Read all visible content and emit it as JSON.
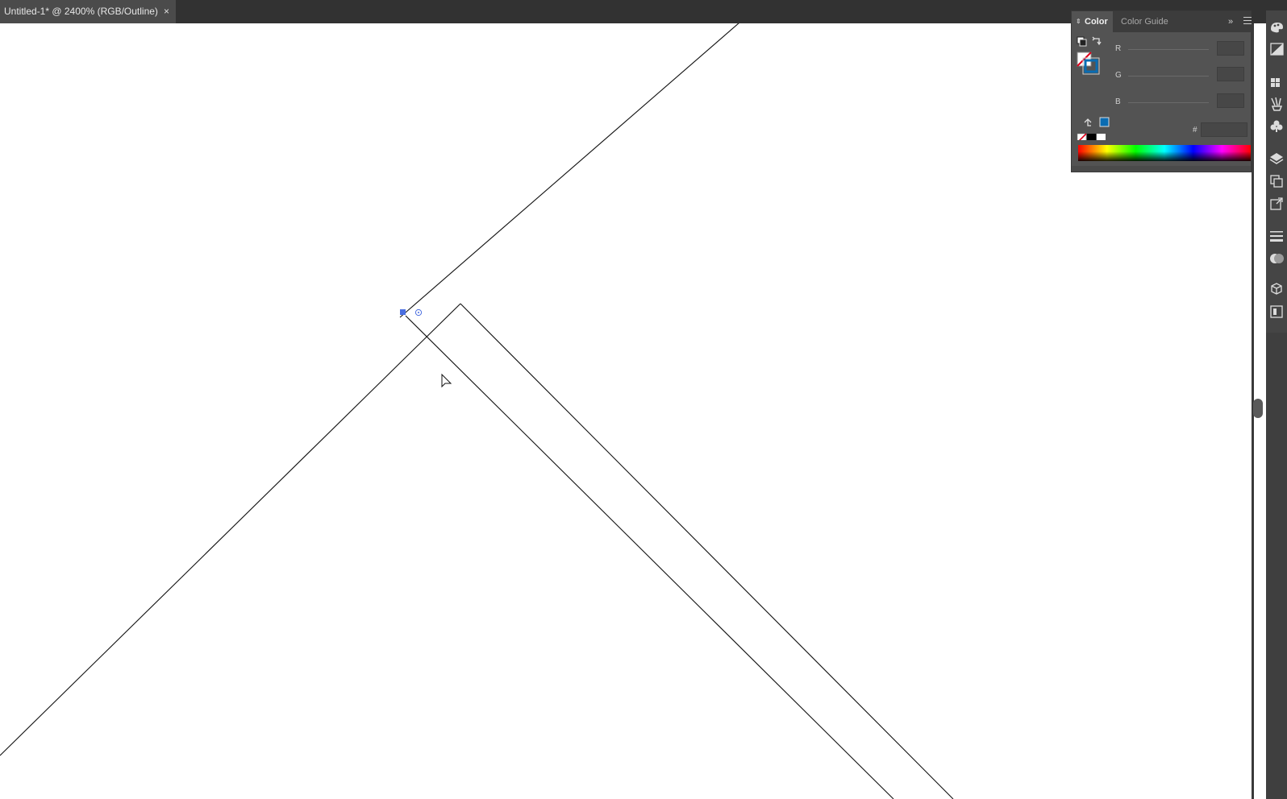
{
  "document_tab": {
    "title": "Untitled-1* @ 2400% (RGB/Outline)",
    "close_glyph": "×"
  },
  "color_panel": {
    "tabs": [
      {
        "label": "Color",
        "active": true
      },
      {
        "label": "Color Guide",
        "active": false
      }
    ],
    "tab_arrows_glyph": "⇕",
    "collapse_glyph": "»",
    "sliders": [
      {
        "label": "R",
        "value": ""
      },
      {
        "label": "G",
        "value": ""
      },
      {
        "label": "B",
        "value": ""
      }
    ],
    "hex_label": "#",
    "hex_value": "",
    "fill": "none",
    "stroke_color": "#0a6cb2"
  },
  "right_dock": {
    "icons": [
      "color-icon",
      "gradient-icon",
      "swatches-icon",
      "brushes-icon",
      "symbols-icon",
      "layers-icon",
      "artboards-icon",
      "links-icon",
      "stroke-icon",
      "transparency-icon",
      "3d-icon",
      "libraries-icon"
    ]
  },
  "colors": {
    "ui_dark": "#323232",
    "panel_bg": "#535353",
    "anchor_blue": "#4a6ee0"
  }
}
